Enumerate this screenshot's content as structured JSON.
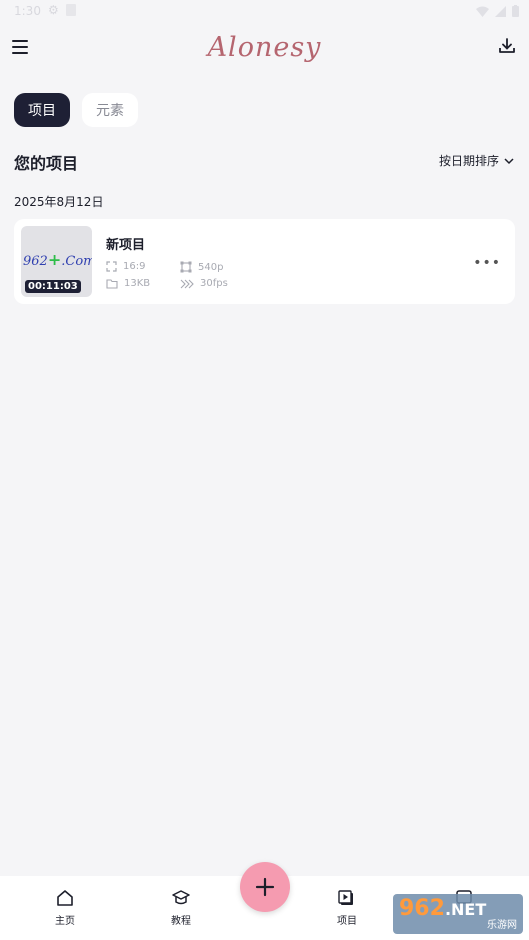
{
  "status_bar": {
    "time": "1:30"
  },
  "header": {
    "logo": "Alonesy"
  },
  "tabs": [
    {
      "label": "项目",
      "active": true
    },
    {
      "label": "元素",
      "active": false
    }
  ],
  "section": {
    "title": "您的项目",
    "sort_label": "按日期排序"
  },
  "group": {
    "date": "2025年8月12日"
  },
  "project": {
    "title": "新项目",
    "duration": "00:11:03",
    "aspect": "16:9",
    "size": "13KB",
    "resolution": "540p",
    "fps": "30fps",
    "thumb_text_left": "962",
    "thumb_text_right": ".Com",
    "thumb_plus": "+"
  },
  "nav": [
    {
      "label": "主页",
      "icon": "home-icon"
    },
    {
      "label": "教程",
      "icon": "graduation-cap-icon"
    },
    {
      "label": "项目",
      "icon": "video-project-icon"
    },
    {
      "label": "",
      "icon": "message-icon"
    }
  ],
  "fab": {
    "icon": "plus-icon"
  },
  "watermark": {
    "number": "962",
    "suffix": ".NET",
    "caption": "乐游网"
  },
  "colors": {
    "accent_dark": "#1e2035",
    "fab_pink": "#f59bb0",
    "logo": "#b5656f"
  }
}
